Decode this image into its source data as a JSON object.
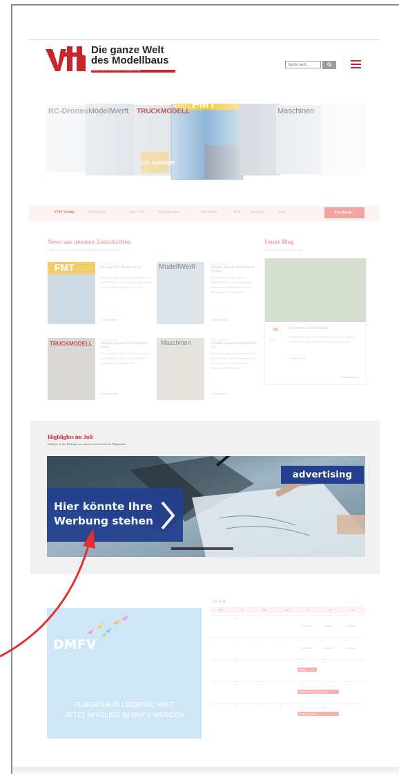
{
  "brand": {
    "title_line1": "Die ganze Welt",
    "title_line2": "des Modellbaus",
    "tagline": "Verlag für Technik und Handwerk neue Medien GmbH"
  },
  "header": {
    "search_placeholder": "Suche nach...",
    "search_icon": "magnifier-icon",
    "menu_icon": "hamburger-icon"
  },
  "magazines": [
    "RC-Drones",
    "ModellWerft",
    "TRUCKMODELL",
    "FMT",
    "Maschinen",
    "175. AUSGABE"
  ],
  "nav": {
    "items": [
      "VTH-Verlag",
      "Abonnement",
      "Abo-Club",
      "Kleinanzeigen",
      "Newsletter",
      "Blog",
      "Kontakt",
      "Shop"
    ],
    "facebook_label": "Facebook"
  },
  "news": {
    "title": "News aus unseren Zeitschriften",
    "subtitle": "Erfahren Sie die wichtigsten Neuigkeiten immer direkt hier",
    "items": [
      {
        "cover": "FMT",
        "date": "Donnerstag, 14.07.2016",
        "title": "Die neue FMT 08/2016 ist da!",
        "text": "Rein, hell und rot ist das Titelmodell der FMT 08/2016. Dabei hat der Pink Special 1 a 5 mm MACH light nur 40 cm...",
        "more": "» weiterlesen"
      },
      {
        "cover": "ModellWerft",
        "date": "Montag, 13.06.2016",
        "title": "Aktuelle Ausgabe ModellWerft 07/2016",
        "text": "Das Titelmodell der neu en ModellWerft ist ein aufwendiges Ergebnis des Eisenachan Ansons Helgoland im Großmodell.",
        "more": "» weiterlesen"
      },
      {
        "cover": "TRUCKMODELL",
        "date": "Montag, 06.06.2016",
        "title": "Aktuelle Ausgabe TRUCKmodell 3/2016",
        "text": "175 Ausgaben TRUCKmodell - wir sind ein Jubiläum, welches wir mit dieser Ausgabe feiern dürfen. Die...",
        "more": "» weiterlesen"
      },
      {
        "cover": "Maschinen",
        "date": "Montag, 23.05.2016",
        "title": "Aktuelle Ausgabe MASCHINEN IM...",
        "text": "In dieser Ausgabe zeigen werden Sie spezell in aller Ian der Beitrage zum das Auspielen wird Hopper für Modelle am Werkshop...",
        "more": "» weiterlesen"
      }
    ]
  },
  "blog": {
    "title": "Unser Blog",
    "subtitle": "Neuigkeiten aus unserem Blog",
    "card_day": "Mi",
    "card_date": "08.06.",
    "card_title": "Treadkitten an der Ahmetik",
    "card_text": "ModellWerft Autor Peter Rehrin hat seit auf Ugredan Großmodelle aus Marinemodellen sprechen. Die...",
    "more": "» weiterlesen"
  },
  "highlights": {
    "title": "Highlights im Juli",
    "subtitle": "Einblick in die Beiträge aus unseren verschiedenen Magazinen",
    "badge": "advertising",
    "ad_line1": "Hier könnte Ihre",
    "ad_line2": "Werbung stehen"
  },
  "dmfv": {
    "logo": "DMFV",
    "line1": "FLIEGEN AUS LEIDENSCHAFT",
    "line2": "JETZT MITGLIED IM DMFV WERDEN"
  },
  "calendar": {
    "month": "Juli 2016",
    "weekdays": [
      "Mo",
      "Di",
      "Mi",
      "Do",
      "Fr",
      "Sa",
      "So"
    ],
    "days": [
      "27",
      "28",
      "29",
      "30",
      "1",
      "2",
      "3",
      "4",
      "5",
      "6",
      "7",
      "8",
      "9",
      "10",
      "11",
      "12",
      "13",
      "14",
      "15",
      "16",
      "17",
      "18",
      "19",
      "20",
      "21",
      "22",
      "23",
      "24",
      "25",
      "26",
      "27",
      "28",
      "29",
      "30",
      "31"
    ],
    "event_label": "» Termine",
    "pill_label": "Flugtag",
    "pill2_label": "VTH Tag Kultur der Technik",
    "pill3_label": "Treffen Modellbau"
  },
  "colors": {
    "brand_red": "#c8262c",
    "ad_blue": "#23408e",
    "arrow_red": "#e32f2f"
  }
}
